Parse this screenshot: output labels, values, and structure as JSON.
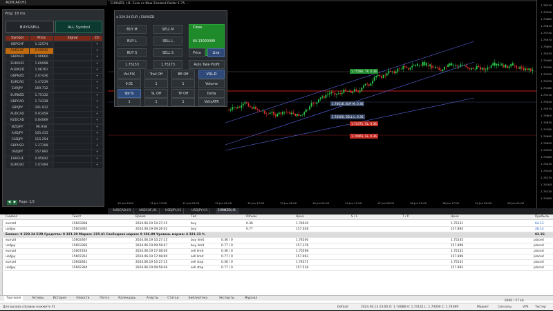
{
  "left_panel": {
    "title": "AUDCAD,H1",
    "ping": "Ping: 18 ms",
    "buysell_label": "BUY&SELL",
    "allsym_label": "ALL Symbol",
    "headers": [
      "Symbol",
      "Price",
      "Signal",
      "Ch"
    ],
    "rows": [
      {
        "symbol": "GBPCHF",
        "price": "1.12574",
        "ch": "+"
      },
      {
        "symbol": "AUDCHF",
        "price": "0.59030",
        "ch": "+"
      },
      {
        "symbol": "GBPAUD",
        "price": "1.90660",
        "ch": "+"
      },
      {
        "symbol": "EURAUD",
        "price": "1.60998",
        "ch": "+"
      },
      {
        "symbol": "AUDNZD",
        "price": "1.08761",
        "ch": "+"
      },
      {
        "symbol": "GBPNZD",
        "price": "2.07436",
        "ch": "+"
      },
      {
        "symbol": "EURCAD",
        "price": "1.47239",
        "ch": "+"
      },
      {
        "symbol": "EURJPY",
        "price": "169.712",
        "ch": "+"
      },
      {
        "symbol": "EURNZD",
        "price": "1.75132",
        "ch": "+"
      },
      {
        "symbol": "GBPCAD",
        "price": "1.74338",
        "ch": "+"
      },
      {
        "symbol": "GBPJPY",
        "price": "201.012",
        "ch": "+"
      },
      {
        "symbol": "AUDCAD",
        "price": "0.91459",
        "ch": "+"
      },
      {
        "symbol": "NZDCAD",
        "price": "0.84069",
        "ch": "+"
      },
      {
        "symbol": "NZDJPY",
        "price": "96.938",
        "ch": "+"
      },
      {
        "symbol": "AUDJPY",
        "price": "105.415",
        "ch": "+"
      },
      {
        "symbol": "CADJPY",
        "price": "115.254",
        "ch": "+"
      },
      {
        "symbol": "GBPUSD",
        "price": "1.27308",
        "ch": "+"
      },
      {
        "symbol": "USDJPY",
        "price": "157.892",
        "ch": "+"
      },
      {
        "symbol": "EURCHF",
        "price": "0.95042",
        "ch": "+"
      },
      {
        "symbol": "EURUSD",
        "price": "1.07494",
        "ch": "+"
      }
    ],
    "selected_index": 1,
    "pager_prev": "◀",
    "pager_next": "▶",
    "page_label": "Page: 1/2"
  },
  "chart": {
    "title": "EURNZD, H1: Euro vs New Zealand Dollar  1.75 ...",
    "trade_panel_title": "$ 229.24 EUR | EURNZD",
    "buttons": {
      "buy_m": "BUY M",
      "sell_m": "SELL M",
      "close": "Close",
      "buy_l": "BUY L",
      "sell_l": "SELL L",
      "buy_s": "BUY S",
      "sell_s": "SELL S",
      "price": "Price",
      "line": "Line",
      "bid": "1.75153",
      "ask": "1.75173",
      "auto_take": "Auto Take Profit",
      "vol_fix": "Vol-FIX",
      "trail_off": "Trail Off",
      "be_off": "BE Off",
      "vol_d": "VOL-D",
      "v1": "0.01",
      "v2": "1",
      "v3": "1",
      "volume": "Volume",
      "vol_pct": "Vol %",
      "sl_off": "SL Off",
      "tp_off": "TP Off",
      "delta": "Delta",
      "v4": "1",
      "v5": "1",
      "v6": "1",
      "volty": "VoltyATR"
    },
    "close_value": "64.13000000",
    "price_labels": [
      "1.76010",
      "1.75950",
      "1.75880",
      "1.75810",
      "1.75740",
      "1.75670",
      "1.75600",
      "1.75530",
      "1.75460",
      "1.75390",
      "1.75320",
      "1.75250",
      "1.75180",
      "1.75110",
      "1.75040",
      "1.74970",
      "1.74900",
      "1.74830",
      "1.74760",
      "1.74690",
      "1.74620",
      "1.74550",
      "1.74480",
      "1.74410",
      "1.74340",
      "1.74270",
      "1.74200",
      "1.74130",
      "1.74060"
    ],
    "time_labels": [
      "10 Jun 2024",
      "11 Jun 17:00",
      "11 Jun 09:00",
      "12 Jun 01:00",
      "12 Jun 17:00",
      "13 Jun 09:00",
      "14 Jun 01:00",
      "14 Jun 17:00",
      "17 Jun 09:00",
      "18 Jun 01:00",
      "18 Jun 17:00",
      "19 Jun 09:00",
      "20 Jun 01:00"
    ],
    "order_labels": [
      {
        "text": "1.75580, TP, 0.36",
        "kind": "tp"
      },
      {
        "text": "1.74618, BUY M, 0.36",
        "kind": "buy"
      },
      {
        "text": "1.74500, SELL L, 0.36",
        "kind": "buy"
      },
      {
        "text": "1.74371, SL, 0.36",
        "kind": "sl"
      },
      {
        "text": "1.74065, SL, 0.36",
        "kind": "sl"
      }
    ],
    "colors": {
      "up": "#2bd24a",
      "down": "#e03030",
      "channel": "#5a6ae8",
      "red_line": "#c81e1e"
    }
  },
  "chart_tabs": [
    "AUDCAD,H1",
    "AUDCHF,H1",
    "USDJPY,H1",
    "USDJPY,H1",
    "EURNZD,H1"
  ],
  "active_chart_tab": 4,
  "terminal": {
    "headers": [
      "Символ",
      "Тикет",
      "Время",
      "Тип",
      "Объем",
      "Цена",
      "S / L",
      "T / P",
      "Цена",
      "Прибыль"
    ],
    "rows": [
      {
        "sym": "eurnzd",
        "ticket": "15603368",
        "time": "2024.06.19 10:27:15",
        "type": "buy",
        "vol": "0.36",
        "price": "1.74619",
        "sl": "",
        "tp": "",
        "cur": "1.75131",
        "profit": "64.13"
      },
      {
        "sym": "usdjpy",
        "ticket": "15603365",
        "time": "2024.06.19 09:26:02",
        "type": "buy",
        "vol": "0.77",
        "price": "157.658",
        "sl": "",
        "tp": "",
        "cur": "157.892",
        "profit": "28.13"
      }
    ],
    "balance_line": "Баланс: 9 229.24 EUR  Средства: 9 321.30  Маржа: 215.41  Свободная маржа: 9 106.89  Уровень маржи: 4 321.33 %",
    "balance_profit": "92.26",
    "pending": [
      {
        "sym": "eurnzd",
        "ticket": "15603367",
        "time": "2024.06.19 10:27:15",
        "type": "buy limit",
        "vol": "0.36 / 0",
        "price": "1.74500",
        "cur": "1.75145",
        "status": "placed"
      },
      {
        "sym": "usdjpy",
        "ticket": "15603366",
        "time": "2024.06.19 09:58:47",
        "type": "buy limit",
        "vol": "0.77 / 0",
        "price": "157.378",
        "cur": "157.899",
        "status": "placed"
      },
      {
        "sym": "eurnzd",
        "ticket": "15607263",
        "time": "2024.06.19 17:08:00",
        "type": "sell limit",
        "vol": "0.36 / 0",
        "price": "1.75598",
        "cur": "1.75131",
        "status": "placed"
      },
      {
        "sym": "usdjpy",
        "ticket": "15607262",
        "time": "2024.06.19 17:08:00",
        "type": "sell limit",
        "vol": "0.77 / 0",
        "price": "157.993",
        "cur": "157.899",
        "status": "placed"
      },
      {
        "sym": "eurnzd",
        "ticket": "15602841",
        "time": "2024.06.19 10:27:15",
        "type": "sell stop",
        "vol": "0.36 / 0",
        "price": "1.74371",
        "cur": "1.75131",
        "status": "placed"
      },
      {
        "sym": "usdjpy",
        "ticket": "15602394",
        "time": "2024.06.19 09:58:46",
        "type": "sell stop",
        "vol": "0.77 / 0",
        "price": "157.518",
        "cur": "157.892",
        "status": "placed"
      }
    ],
    "tabs": [
      "Торговля",
      "Активы",
      "История",
      "Новости",
      "Почта",
      "Календарь",
      "Алерты",
      "Статьи",
      "Библиотека",
      "Эксперты",
      "Журнал"
    ],
    "status_left": "Для вызова справки нажмите F1",
    "status_default": "Default",
    "status_ohlc": "2024.06.13 23:00   O: 1.74088   H: 1.74141   L: 1.74000   C: 1.74069",
    "market": "Маркет",
    "signals": "Сигналы",
    "vps": "VPS",
    "tester": "Тестер",
    "net": "6900 / 57 kb"
  }
}
